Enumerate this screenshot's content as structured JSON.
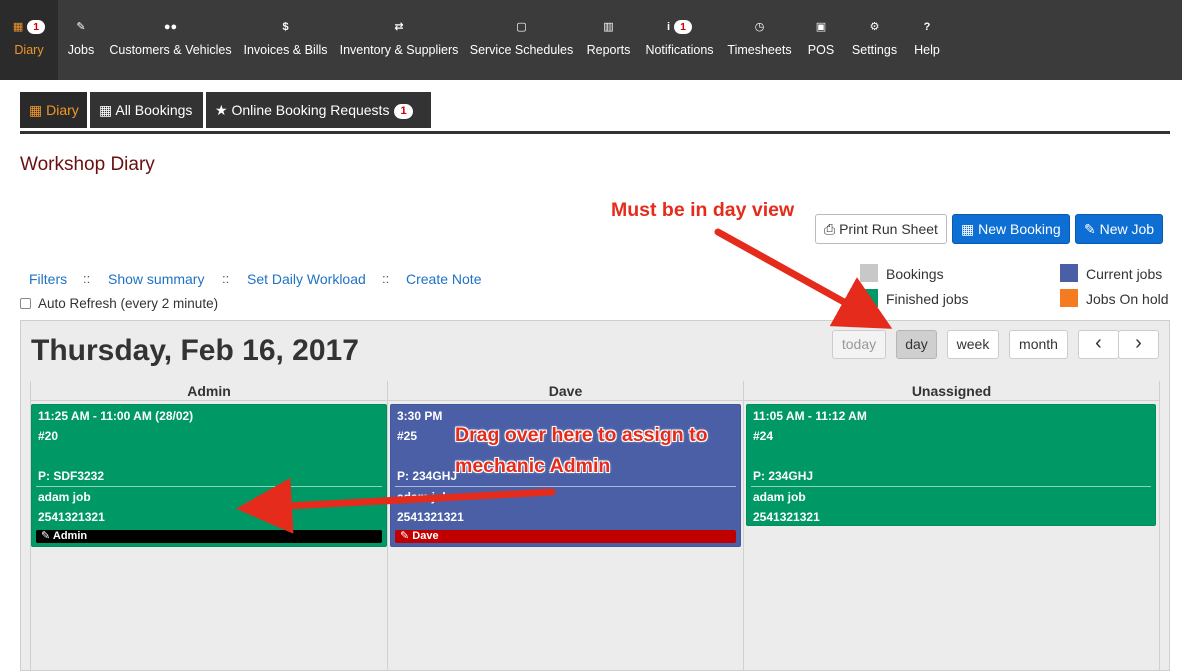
{
  "topnav": {
    "items": [
      {
        "label": "Diary",
        "icon": "calendar-icon",
        "glyph": "▦",
        "badge": "1"
      },
      {
        "label": "Jobs",
        "icon": "wrench-icon",
        "glyph": "✎"
      },
      {
        "label": "Customers & Vehicles",
        "icon": "users-icon",
        "glyph": "●●"
      },
      {
        "label": "Invoices & Bills",
        "icon": "dollar-icon",
        "glyph": "$"
      },
      {
        "label": "Inventory & Suppliers",
        "icon": "exchange-icon",
        "glyph": "⇄"
      },
      {
        "label": "Service Schedules",
        "icon": "calendar-o-icon",
        "glyph": "▢"
      },
      {
        "label": "Reports",
        "icon": "bar-chart-icon",
        "glyph": "▥"
      },
      {
        "label": "Notifications",
        "icon": "info-icon",
        "glyph": "i",
        "badge": "1"
      },
      {
        "label": "Timesheets",
        "icon": "clock-icon",
        "glyph": "◷"
      },
      {
        "label": "POS",
        "icon": "money-icon",
        "glyph": "▣"
      },
      {
        "label": "Settings",
        "icon": "cogs-icon",
        "glyph": "⚙"
      },
      {
        "label": "Help",
        "icon": "question-icon",
        "glyph": "?"
      }
    ]
  },
  "subtabs": [
    {
      "label": "Diary",
      "glyph": "▦"
    },
    {
      "label": "All Bookings",
      "glyph": "▦"
    },
    {
      "label": "Online Booking Requests",
      "glyph": "★",
      "badge": "1"
    }
  ],
  "page_title": "Workshop Diary",
  "actions": {
    "print": "Print Run Sheet",
    "new_booking": "New Booking",
    "new_job": "New Job"
  },
  "links": {
    "filters": "Filters",
    "summary": "Show summary",
    "workload": "Set Daily Workload",
    "note": "Create Note",
    "separator": "::"
  },
  "auto_refresh": "Auto Refresh (every 2 minute)",
  "legend": [
    {
      "label": "Bookings",
      "color": "#c8c8c8"
    },
    {
      "label": "Finished jobs",
      "color": "#009966"
    },
    {
      "label": "Current jobs",
      "color": "#4a5fa6"
    },
    {
      "label": "Jobs On hold",
      "color": "#f47b20"
    }
  ],
  "calendar": {
    "date_title": "Thursday, Feb 16, 2017",
    "views": {
      "today": "today",
      "day": "day",
      "week": "week",
      "month": "month"
    },
    "active_view": "day",
    "prev": "‹",
    "next": "›",
    "columns": [
      "Admin",
      "Dave",
      "Unassigned"
    ],
    "events": [
      {
        "time": "11:25 AM - 11:00 AM (28/02)",
        "job": "#20",
        "plate": "P: SDF3232",
        "desc": "adam job",
        "phone": "2541321321",
        "mechanic": "Admin",
        "color": "#009966",
        "mech_color": "#000000"
      },
      {
        "time": "3:30 PM",
        "job": "#25",
        "plate": "P: 234GHJ",
        "desc": "adam job",
        "phone": "2541321321",
        "mechanic": "Dave",
        "color": "#4a5fa6",
        "mech_color": "#c00000"
      },
      {
        "time": "11:05 AM - 11:12 AM",
        "job": "#24",
        "plate": "P: 234GHJ",
        "desc": "adam job",
        "phone": "2541321321",
        "mechanic": "",
        "color": "#009966",
        "mech_color": ""
      }
    ]
  },
  "annotations": {
    "day_view": "Must be in day view",
    "drag_line1": "Drag over here to assign to",
    "drag_line2": "mechanic Admin",
    "color": "#e52b1b"
  }
}
